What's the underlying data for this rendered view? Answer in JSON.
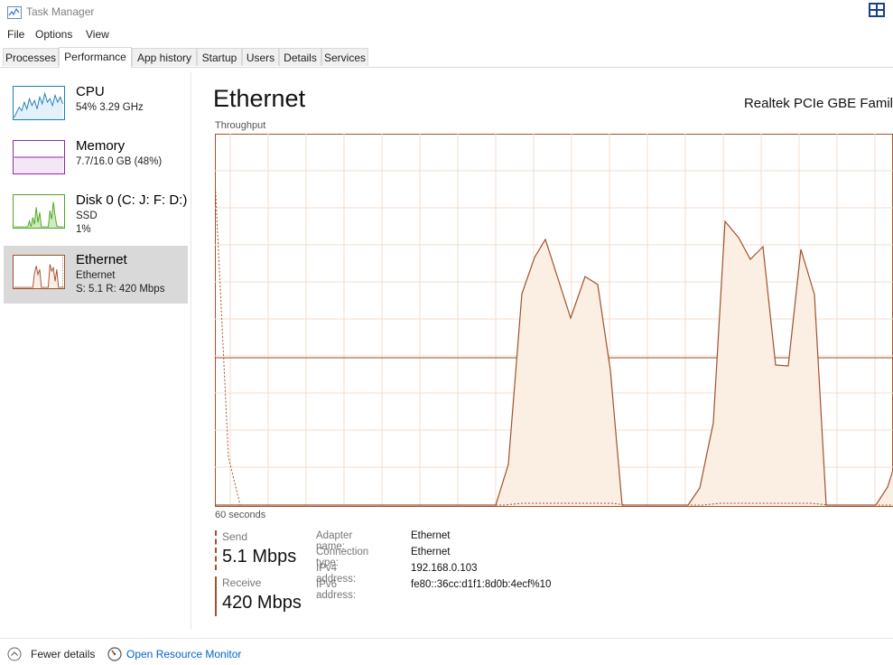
{
  "window": {
    "title": "Task Manager"
  },
  "menu": [
    "File",
    "Options",
    "View"
  ],
  "tabs": [
    "Processes",
    "Performance",
    "App history",
    "Startup",
    "Users",
    "Details",
    "Services"
  ],
  "active_tab": "Performance",
  "sidebar": [
    {
      "title": "CPU",
      "lines": [
        "54%  3.29 GHz"
      ],
      "color": "#1c7fb8"
    },
    {
      "title": "Memory",
      "lines": [
        "7.7/16.0 GB (48%)"
      ],
      "color": "#8b2a9c"
    },
    {
      "title": "Disk 0 (C: J: F: D:)",
      "lines": [
        "SSD",
        "1%"
      ],
      "color": "#4da527"
    },
    {
      "title": "Ethernet",
      "lines": [
        "Ethernet",
        "S: 5.1  R: 420 Mbps"
      ],
      "color": "#a0522d",
      "selected": true
    }
  ],
  "main": {
    "title": "Ethernet",
    "adapter_model": "Realtek PCIe GBE Famil",
    "throughput_label": "Throughput",
    "seconds_label": "60 seconds"
  },
  "stats": {
    "send_label": "Send",
    "send_value": "5.1 Mbps",
    "receive_label": "Receive",
    "receive_value": "420 Mbps"
  },
  "info": [
    {
      "key": "Adapter name:",
      "value": "Ethernet"
    },
    {
      "key": "Connection type:",
      "value": "Ethernet"
    },
    {
      "key": "IPv4 address:",
      "value": "192.168.0.103"
    },
    {
      "key": "IPv6 address:",
      "value": "fe80::36cc:d1f1:8d0b:4ecf%10"
    }
  ],
  "footer": {
    "fewer_details": "Fewer details",
    "resource_monitor": "Open Resource Monitor"
  },
  "colors": {
    "ethernet": "#a0522d",
    "ethernet_fill": "#fbeee3",
    "grid": "#f0dccd"
  }
}
